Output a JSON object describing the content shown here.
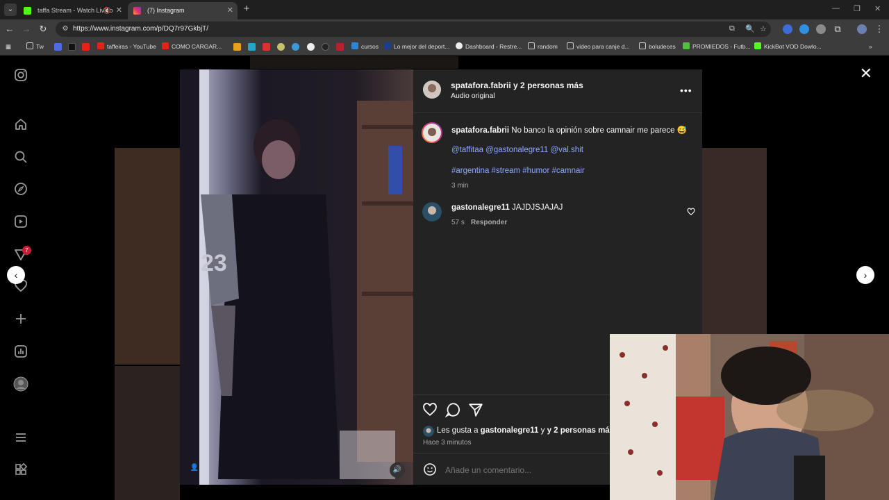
{
  "browser": {
    "tabs": [
      {
        "title": "taffa Stream - Watch Live o",
        "favicon_color": "#53fc18",
        "muted": true
      },
      {
        "title": "(7) Instagram",
        "favicon_color": "#e1306c",
        "active": true
      }
    ],
    "url": "https://www.instagram.com/p/DQ7r97GkbjT/",
    "bookmarks": [
      {
        "label": "Tw"
      },
      {
        "label": "taffeiras - YouTube"
      },
      {
        "label": "COMO CARGAR..."
      },
      {
        "label": "cursos"
      },
      {
        "label": "Lo mejor del deport..."
      },
      {
        "label": "Dashboard - Restre..."
      },
      {
        "label": "random"
      },
      {
        "label": "video para canje d..."
      },
      {
        "label": "boludeces"
      },
      {
        "label": "PROMIEDOS - Futb..."
      },
      {
        "label": "KickBot VOD Dowlo..."
      }
    ]
  },
  "instagram": {
    "notifications_badge": "7",
    "post": {
      "header_user": "spatafora.fabrii",
      "header_suffix": "y 2 personas más",
      "audio": "Audio original",
      "caption_user": "spatafora.fabrii",
      "caption_text": "No banco la opinión sobre camnair me parece 😅",
      "mentions": "@taffitaa @gastonalegre11 @val.shit",
      "hashtags": "#argentina #stream #humor #camnair",
      "caption_time": "3 min",
      "comments": [
        {
          "user": "gastonalegre11",
          "text": "JAJDJSJAJAJ",
          "time": "57 s",
          "reply": "Responder"
        }
      ],
      "likes_prefix": "Les gusta a",
      "likes_user": "gastonalegre11",
      "likes_suffix": "y 2 personas más",
      "posted_time": "Hace 3 minutos",
      "comment_placeholder": "Añade un comentario..."
    }
  }
}
